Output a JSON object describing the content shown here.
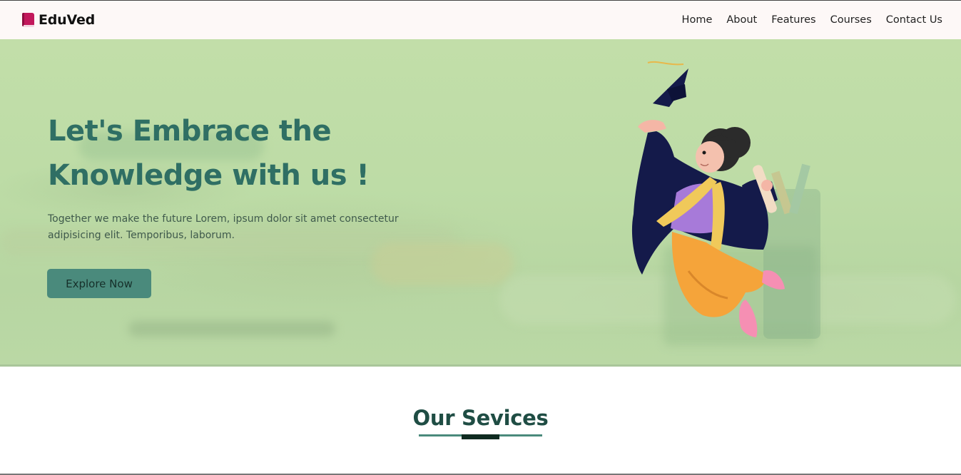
{
  "brand": {
    "name": "EduVed",
    "icon": "book-icon",
    "icon_color": "#c2185b"
  },
  "nav": {
    "links": [
      {
        "label": "Home"
      },
      {
        "label": "About"
      },
      {
        "label": "Features"
      },
      {
        "label": "Courses"
      },
      {
        "label": "Contact Us"
      }
    ]
  },
  "hero": {
    "title_line1": "Let's Embrace the",
    "title_line2": "Knowledge with us !",
    "text": "Together we make the future Lorem, ipsum dolor sit amet consectetur adipisicing elit. Temporibus, laborum.",
    "button_label": "Explore Now",
    "illustration": "graduate-student-illustration",
    "colors": {
      "title": "#2f6f64",
      "button": "#4a8a7c",
      "background": "#bfdca7"
    }
  },
  "services": {
    "title": "Our Sevices"
  }
}
